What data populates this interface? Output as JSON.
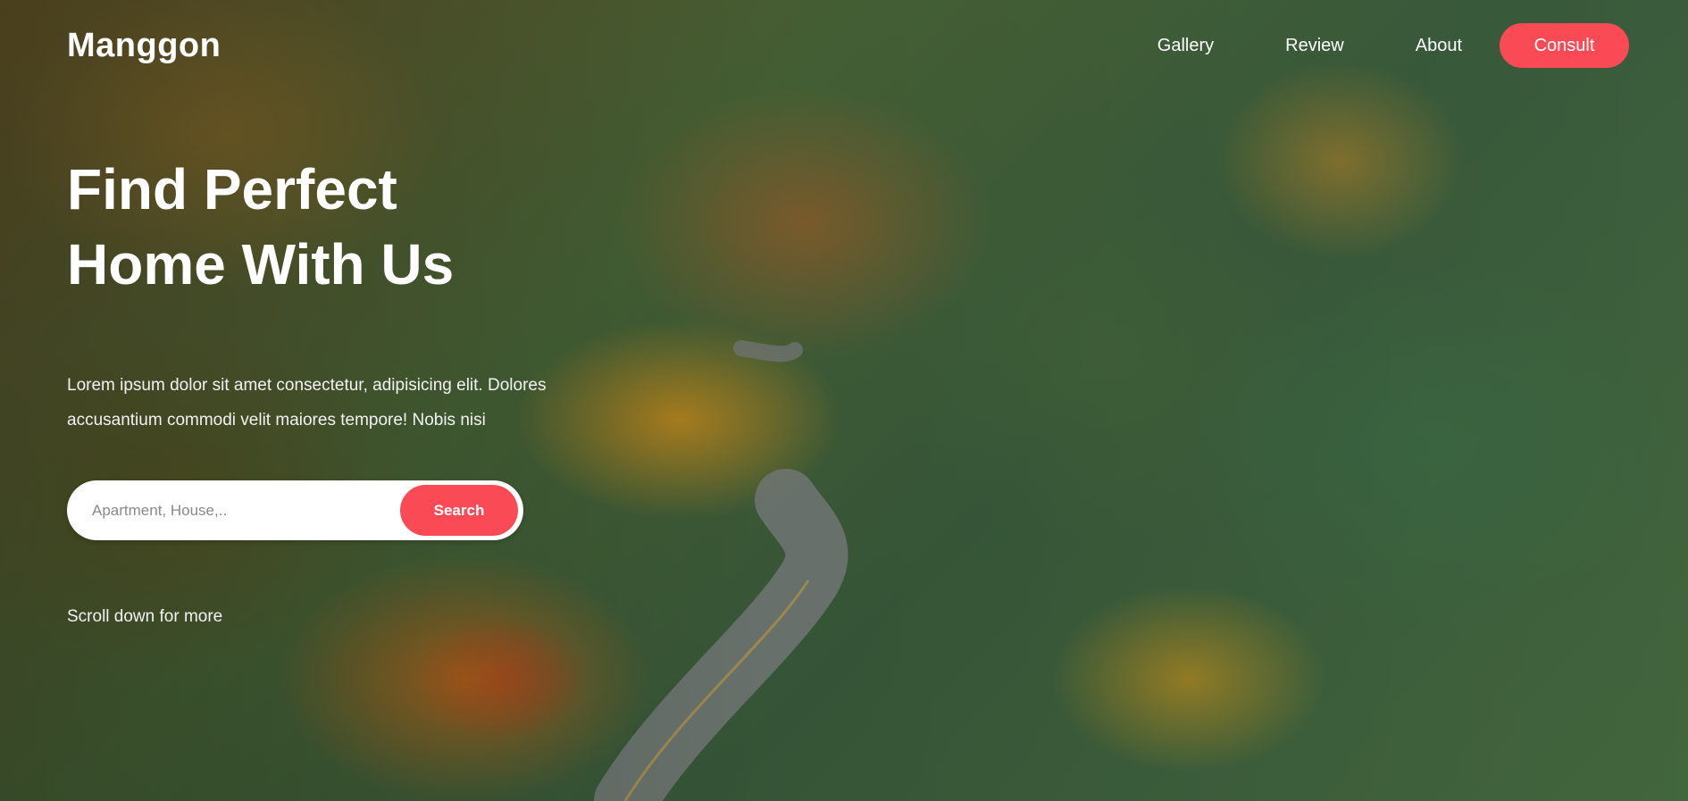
{
  "brand": {
    "name": "Manggon",
    "accent_color": "#fa4a55"
  },
  "nav": {
    "gallery_label": "Gallery",
    "review_label": "Review",
    "about_label": "About",
    "consult_label": "Consult"
  },
  "hero": {
    "title_line1": "Find Perfect",
    "title_line2": "Home With Us",
    "desc_line1": "Lorem ipsum dolor sit amet consectetur, adipisicing elit. Dolores",
    "desc_line2": "accusantium commodi velit maiores tempore! Nobis nisi"
  },
  "search": {
    "placeholder": "Apartment, House,..",
    "button_label": "Search"
  },
  "scroll_hint": "Scroll down for more"
}
